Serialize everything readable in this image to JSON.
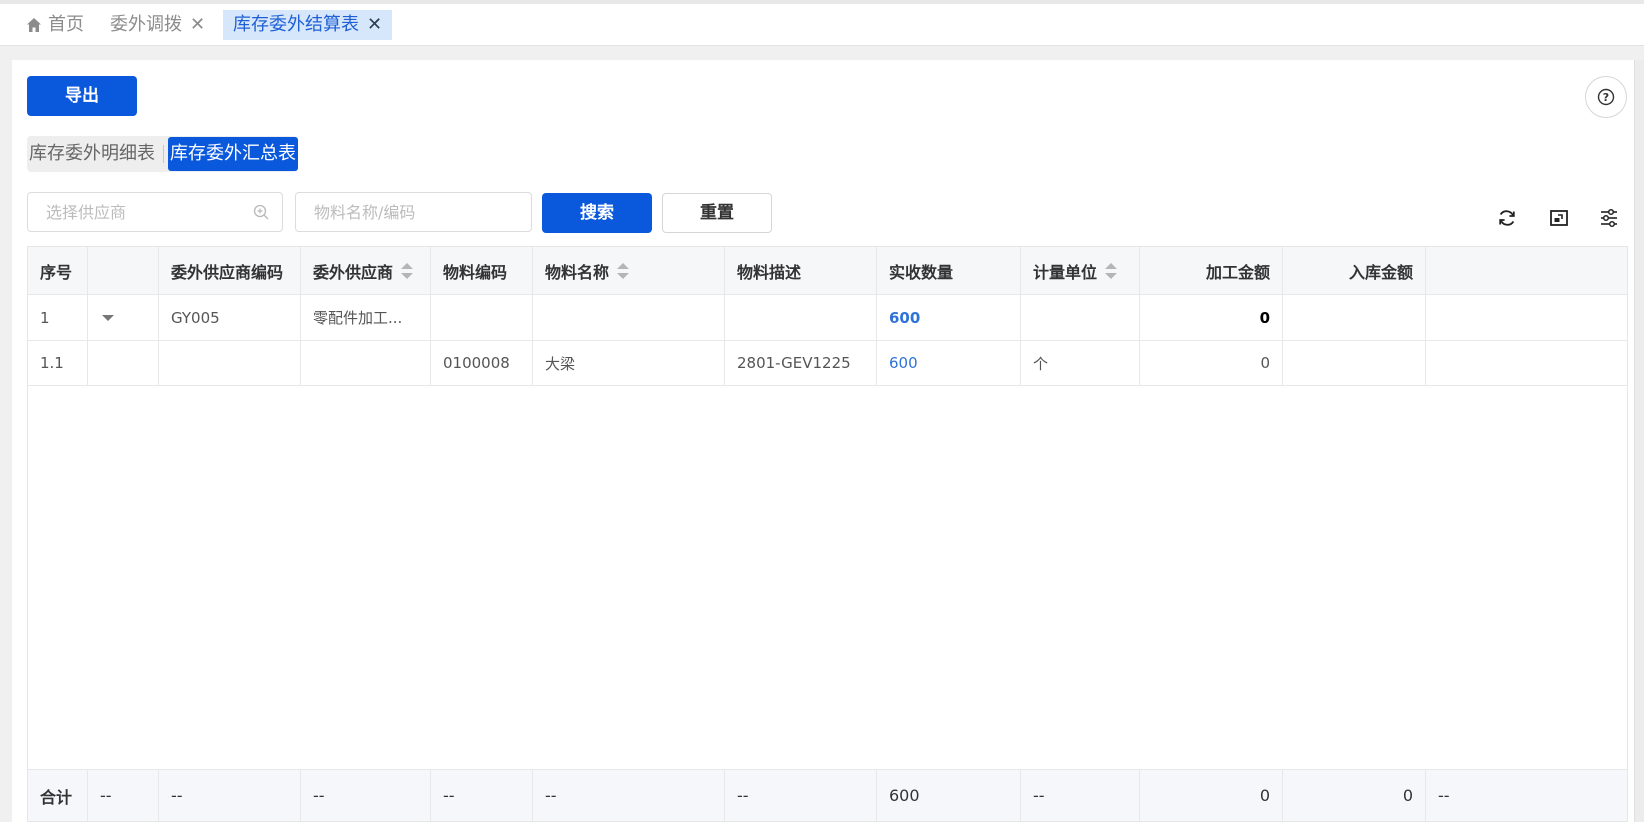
{
  "tabs": {
    "home": {
      "label": "首页",
      "icon": "home-icon"
    },
    "items": [
      {
        "label": "委外调拨",
        "closable": true
      },
      {
        "label": "库存委外结算表",
        "closable": true,
        "active": true
      }
    ],
    "close_glyph": "✕"
  },
  "toolbar": {
    "export_label": "导出",
    "help_glyph": "?"
  },
  "segment": {
    "items": [
      "库存委外明细表",
      "库存委外汇总表"
    ],
    "active_index": 1
  },
  "filters": {
    "supplier_placeholder": "选择供应商",
    "material_placeholder": "物料名称/编码",
    "search_label": "搜索",
    "reset_label": "重置"
  },
  "table": {
    "columns": [
      "序号",
      "",
      "委外供应商编码",
      "委外供应商",
      "物料编码",
      "物料名称",
      "物料描述",
      "实收数量",
      "计量单位",
      "加工金额",
      "入库金额",
      ""
    ],
    "sortable": [
      false,
      false,
      false,
      true,
      false,
      true,
      false,
      false,
      true,
      false,
      false,
      false
    ],
    "rows": [
      {
        "seq": "1",
        "expandable": true,
        "supplier_code": "GY005",
        "supplier": "零配件加工...",
        "material_code": "",
        "material_name": "",
        "material_desc": "",
        "qty": "600",
        "unit": "",
        "process_amount": "0",
        "stock_amount": ""
      },
      {
        "seq": "1.1",
        "expandable": false,
        "supplier_code": "",
        "supplier": "",
        "material_code": "0100008",
        "material_name": "大梁",
        "material_desc": "2801-GEV1225",
        "qty": "600",
        "unit": "个",
        "process_amount": "0",
        "stock_amount": ""
      }
    ],
    "footer": {
      "label": "合计",
      "c1": "--",
      "c2": "--",
      "c3": "--",
      "c4": "--",
      "c5": "--",
      "c6": "--",
      "qty": "600",
      "c8": "--",
      "process_amount": "0",
      "stock_amount": "0",
      "c11": "--"
    }
  },
  "colors": {
    "primary": "#0a59dc",
    "link": "#2f73d8",
    "active_tab_bg": "#d6e6fb"
  }
}
